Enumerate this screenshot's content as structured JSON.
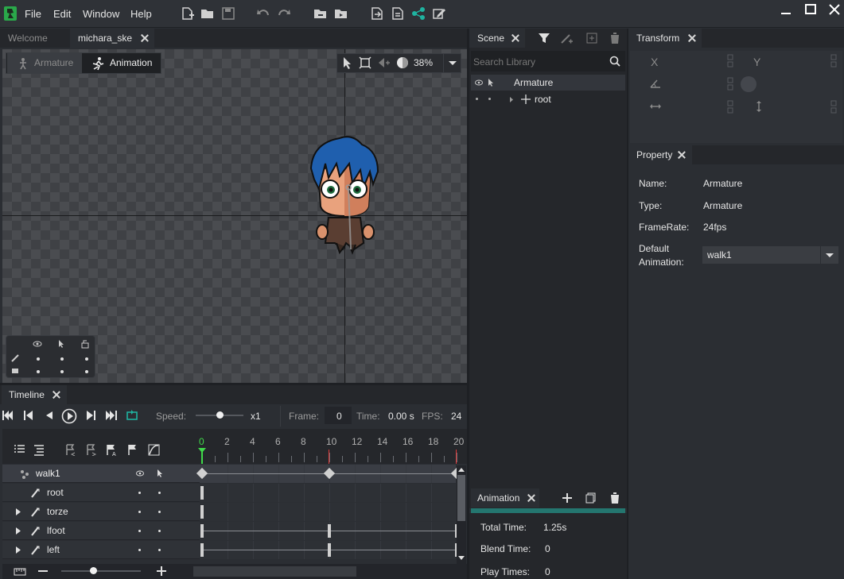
{
  "menubar": {
    "items": [
      "File",
      "Edit",
      "Window",
      "Help"
    ]
  },
  "editor_tabs": [
    {
      "label": "Welcome"
    },
    {
      "label": "michara_ske"
    }
  ],
  "viewport": {
    "modes": {
      "armature": "Armature",
      "animation": "Animation"
    },
    "zoom": "38%",
    "layer_grid": {
      "rows": 2,
      "cols": 3
    }
  },
  "timeline": {
    "title": "Timeline",
    "speed_label": "Speed:",
    "speed_value": "x1",
    "speed_slider_fraction": 0.4,
    "frame_label": "Frame:",
    "frame_value": "0",
    "time_label": "Time:",
    "time_value": "0.00 s",
    "fps_label": "FPS:",
    "fps_value": "24",
    "ruler_ticks": [
      "0",
      "2",
      "4",
      "6",
      "8",
      "10",
      "12",
      "14",
      "16",
      "18",
      "20"
    ],
    "tracks": [
      {
        "name": "walk1",
        "expandable": false,
        "keyframes": [
          0,
          10,
          20
        ]
      },
      {
        "name": "root",
        "expandable": false,
        "keyframes": [
          0
        ]
      },
      {
        "name": "torze",
        "expandable": true,
        "keyframes": [
          0
        ]
      },
      {
        "name": "lfoot",
        "expandable": true,
        "keyframes": [
          0,
          10,
          20
        ]
      },
      {
        "name": "left",
        "expandable": true,
        "keyframes": [
          0,
          10,
          20
        ]
      }
    ],
    "zoom_slider_fraction": 0.5
  },
  "scene": {
    "title": "Scene",
    "search_placeholder": "Search Library",
    "tree": [
      {
        "label": "Armature"
      },
      {
        "label": "root"
      }
    ]
  },
  "transform": {
    "title": "Transform",
    "x_label": "X",
    "y_label": "Y"
  },
  "property": {
    "title": "Property",
    "name_label": "Name:",
    "name_value": "Armature",
    "type_label": "Type:",
    "type_value": "Armature",
    "framerate_label": "FrameRate:",
    "framerate_value": "24fps",
    "default_anim_label_1": "Default",
    "default_anim_label_2": "Animation:",
    "default_anim_value": "walk1"
  },
  "animation_panel": {
    "title": "Animation",
    "total_time_label": "Total Time:",
    "total_time_value": "1.25s",
    "blend_time_label": "Blend Time:",
    "blend_time_value": "0",
    "play_times_label": "Play Times:",
    "play_times_value": "0"
  },
  "colors": {
    "accent": "#1fb3a0",
    "playhead": "#3fd94a",
    "keyframe": "#c8c8c8",
    "mark_red": "#e03a3a",
    "hair": "#1f5fae"
  }
}
